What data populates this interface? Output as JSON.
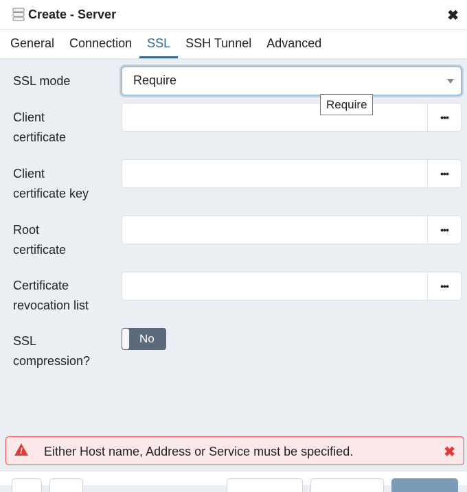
{
  "dialog": {
    "title": "Create - Server",
    "icon": "server-icon",
    "close_icon": "close-icon"
  },
  "tabs": [
    {
      "label": "General"
    },
    {
      "label": "Connection"
    },
    {
      "label": "SSL",
      "active": true
    },
    {
      "label": "SSH Tunnel"
    },
    {
      "label": "Advanced"
    }
  ],
  "form": {
    "ssl_mode": {
      "label": "SSL mode",
      "value": "Require",
      "tooltip": "Require"
    },
    "client_certificate": {
      "label_1": "Client",
      "label_2": "certificate",
      "value": ""
    },
    "client_certificate_key": {
      "label_1": "Client",
      "label_2": "certificate key",
      "value": ""
    },
    "root_certificate": {
      "label_1": "Root",
      "label_2": "certificate",
      "value": ""
    },
    "crl": {
      "label_1": "Certificate",
      "label_2": "revocation list",
      "value": ""
    },
    "ssl_compression": {
      "label_1": "SSL",
      "label_2": "compression?",
      "value": "No"
    },
    "browse_label": "•••"
  },
  "alert": {
    "message": "Either Host name, Address or Service must be specified.",
    "color": "#e03c3c"
  },
  "colors": {
    "accent": "#326690",
    "toggle_off": "#5b6b7b"
  }
}
